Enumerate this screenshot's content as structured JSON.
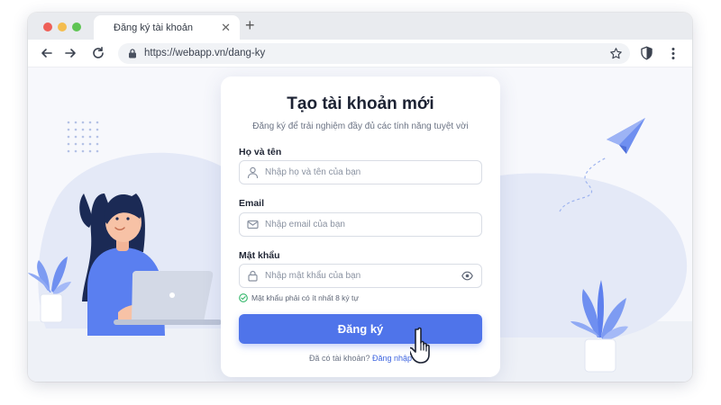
{
  "browser": {
    "tab_title": "Đăng ký tài khoản",
    "url": "https://webapp.vn/dang-ky"
  },
  "form": {
    "title": "Tạo tài khoản mới",
    "subtitle": "Đăng ký để trải nghiệm đầy đủ các tính năng tuyệt vời",
    "name_label": "Họ và tên",
    "name_placeholder": "Nhập họ và tên của bạn",
    "email_label": "Email",
    "email_placeholder": "Nhập email của bạn",
    "password_label": "Mật khẩu",
    "password_placeholder": "Nhập mật khẩu của bạn",
    "password_hint": "Mật khẩu phải có ít nhất 8 ký tự",
    "submit_label": "Đăng ký",
    "login_prompt": "Đã có tài khoản?",
    "login_link": "Đăng nhập"
  },
  "colors": {
    "primary": "#4f74ea",
    "hint_ok": "#2fb567",
    "illustration_blue": "#6f8ff0"
  },
  "icons": [
    "user-icon",
    "mail-icon",
    "lock-icon",
    "eye-icon",
    "check-circle-icon",
    "star-icon",
    "shield-icon",
    "more-vertical-icon",
    "back-icon",
    "forward-icon",
    "reload-icon",
    "paper-plane-icon",
    "hand-cursor-icon"
  ]
}
